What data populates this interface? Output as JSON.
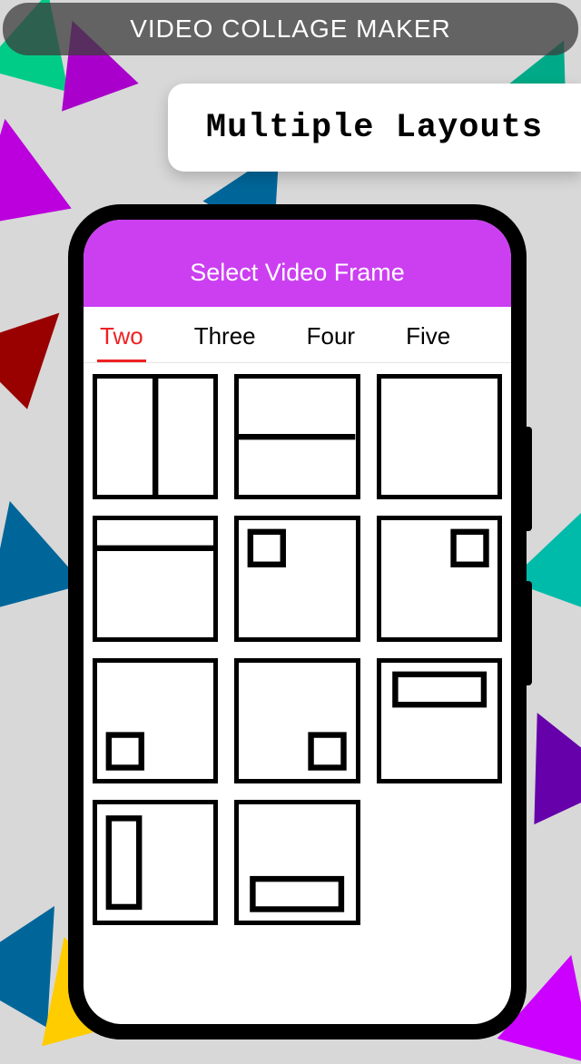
{
  "app_title": "VIDEO COLLAGE MAKER",
  "callout_text": "Multiple Layouts",
  "phone": {
    "header_title": "Select Video Frame",
    "tabs": [
      {
        "label": "Two",
        "active": true
      },
      {
        "label": "Three",
        "active": false
      },
      {
        "label": "Four",
        "active": false
      },
      {
        "label": "Five",
        "active": false
      }
    ],
    "layouts": [
      "two-vertical-split",
      "two-horizontal-split",
      "single-full",
      "header-strip",
      "inset-top-left",
      "inset-top-right",
      "inset-bottom-left",
      "inset-bottom-right",
      "wide-strip-top",
      "tall-strip-left",
      "wide-strip-bottom"
    ]
  }
}
